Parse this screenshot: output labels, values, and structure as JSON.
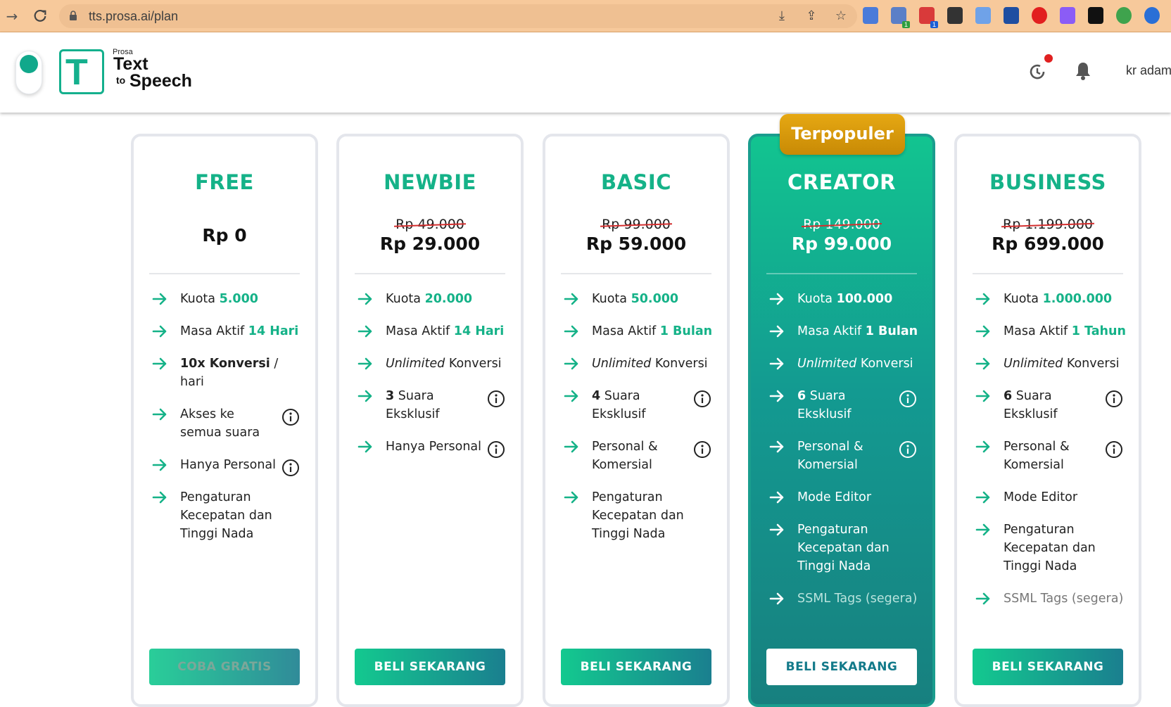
{
  "browser": {
    "url": "tts.prosa.ai/plan"
  },
  "header": {
    "brand_small": "Prosa",
    "brand_text": "Text",
    "brand_to": "to",
    "brand_speech": "Speech",
    "user_name": "kr adam"
  },
  "popular_badge": "Terpopuler",
  "plans": [
    {
      "name": "FREE",
      "old_price": "",
      "price": "Rp 0",
      "features": [
        {
          "pre": "Kuota ",
          "hl": "5.000"
        },
        {
          "pre": "Masa Aktif ",
          "hl": "14 Hari"
        },
        {
          "b": "10x Konversi",
          "post": " / hari"
        },
        {
          "pre": "Akses ke semua suara",
          "info": true
        },
        {
          "pre": "Hanya Personal",
          "info": true
        },
        {
          "pre": "Pengaturan Kecepatan dan Tinggi Nada"
        }
      ],
      "cta": "COBA GRATIS"
    },
    {
      "name": "NEWBIE",
      "old_price": "Rp 49.000",
      "price": "Rp 29.000",
      "features": [
        {
          "pre": "Kuota ",
          "hl": "20.000"
        },
        {
          "pre": "Masa Aktif ",
          "hl": "14 Hari"
        },
        {
          "it": "Unlimited",
          "post": " Konversi"
        },
        {
          "b": "3",
          "post": " Suara Eksklusif",
          "info": true
        },
        {
          "pre": "Hanya Personal",
          "info": true
        }
      ],
      "cta": "BELI SEKARANG"
    },
    {
      "name": "BASIC",
      "old_price": "Rp 99.000",
      "price": "Rp 59.000",
      "features": [
        {
          "pre": "Kuota ",
          "hl": "50.000"
        },
        {
          "pre": "Masa Aktif ",
          "hl": "1 Bulan"
        },
        {
          "it": "Unlimited",
          "post": " Konversi"
        },
        {
          "b": "4",
          "post": " Suara Eksklusif",
          "info": true
        },
        {
          "pre": "Personal & Komersial",
          "info": true
        },
        {
          "pre": "Pengaturan Kecepatan dan Tinggi Nada"
        }
      ],
      "cta": "BELI SEKARANG"
    },
    {
      "name": "CREATOR",
      "old_price": "Rp 149.000",
      "price": "Rp 99.000",
      "features": [
        {
          "pre": "Kuota ",
          "hl": "100.000"
        },
        {
          "pre": "Masa Aktif ",
          "hl": "1 Bulan"
        },
        {
          "it": "Unlimited",
          "post": " Konversi"
        },
        {
          "b": "6",
          "post": " Suara Eksklusif",
          "info": true
        },
        {
          "pre": "Personal & Komersial",
          "info": true
        },
        {
          "pre": "Mode Editor"
        },
        {
          "pre": "Pengaturan Kecepatan dan Tinggi Nada"
        },
        {
          "pre": "SSML Tags (segera)",
          "muted": true
        }
      ],
      "cta": "BELI SEKARANG"
    },
    {
      "name": "BUSINESS",
      "old_price": "Rp 1.199.000",
      "price": "Rp 699.000",
      "features": [
        {
          "pre": "Kuota ",
          "hl": "1.000.000"
        },
        {
          "pre": "Masa Aktif ",
          "hl": "1 Tahun"
        },
        {
          "it": "Unlimited",
          "post": " Konversi"
        },
        {
          "b": "6",
          "post": " Suara Eksklusif",
          "info": true
        },
        {
          "pre": "Personal & Komersial",
          "info": true
        },
        {
          "pre": "Mode Editor"
        },
        {
          "pre": "Pengaturan Kecepatan dan Tinggi Nada"
        },
        {
          "pre": "SSML Tags (segera)",
          "muted": true
        }
      ],
      "cta": "BELI SEKARANG"
    }
  ],
  "colors": {
    "brand_green": "#15b288",
    "popular_gold": "#d99a0b",
    "strike_red": "#d32f2f"
  },
  "icons": {
    "feature_bullet": "arrow-right-icon",
    "feature_info": "info-icon"
  }
}
